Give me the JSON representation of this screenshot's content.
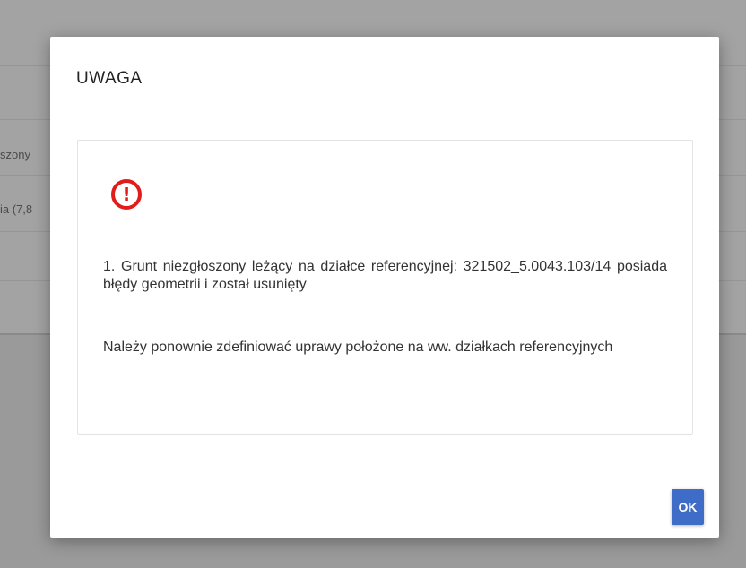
{
  "background": {
    "row_1_fragment": "szony",
    "row_2_fragment": "ia (7,8"
  },
  "dialog": {
    "title": "UWAGA",
    "icon": "exclamation-circle-icon",
    "icon_glyph": "!",
    "icon_color": "#e21b1b",
    "message_1": "1.  Grunt  niezgłoszony  leżący  na  działce  referencyjnej: 321502_5.0043.103/14 posiada błędy geometrii i został usunięty",
    "message_2": "Należy ponownie zdefiniować uprawy położone na ww. działkach referencyjnych",
    "ok_label": "OK",
    "ok_color": "#3f6cc7"
  }
}
